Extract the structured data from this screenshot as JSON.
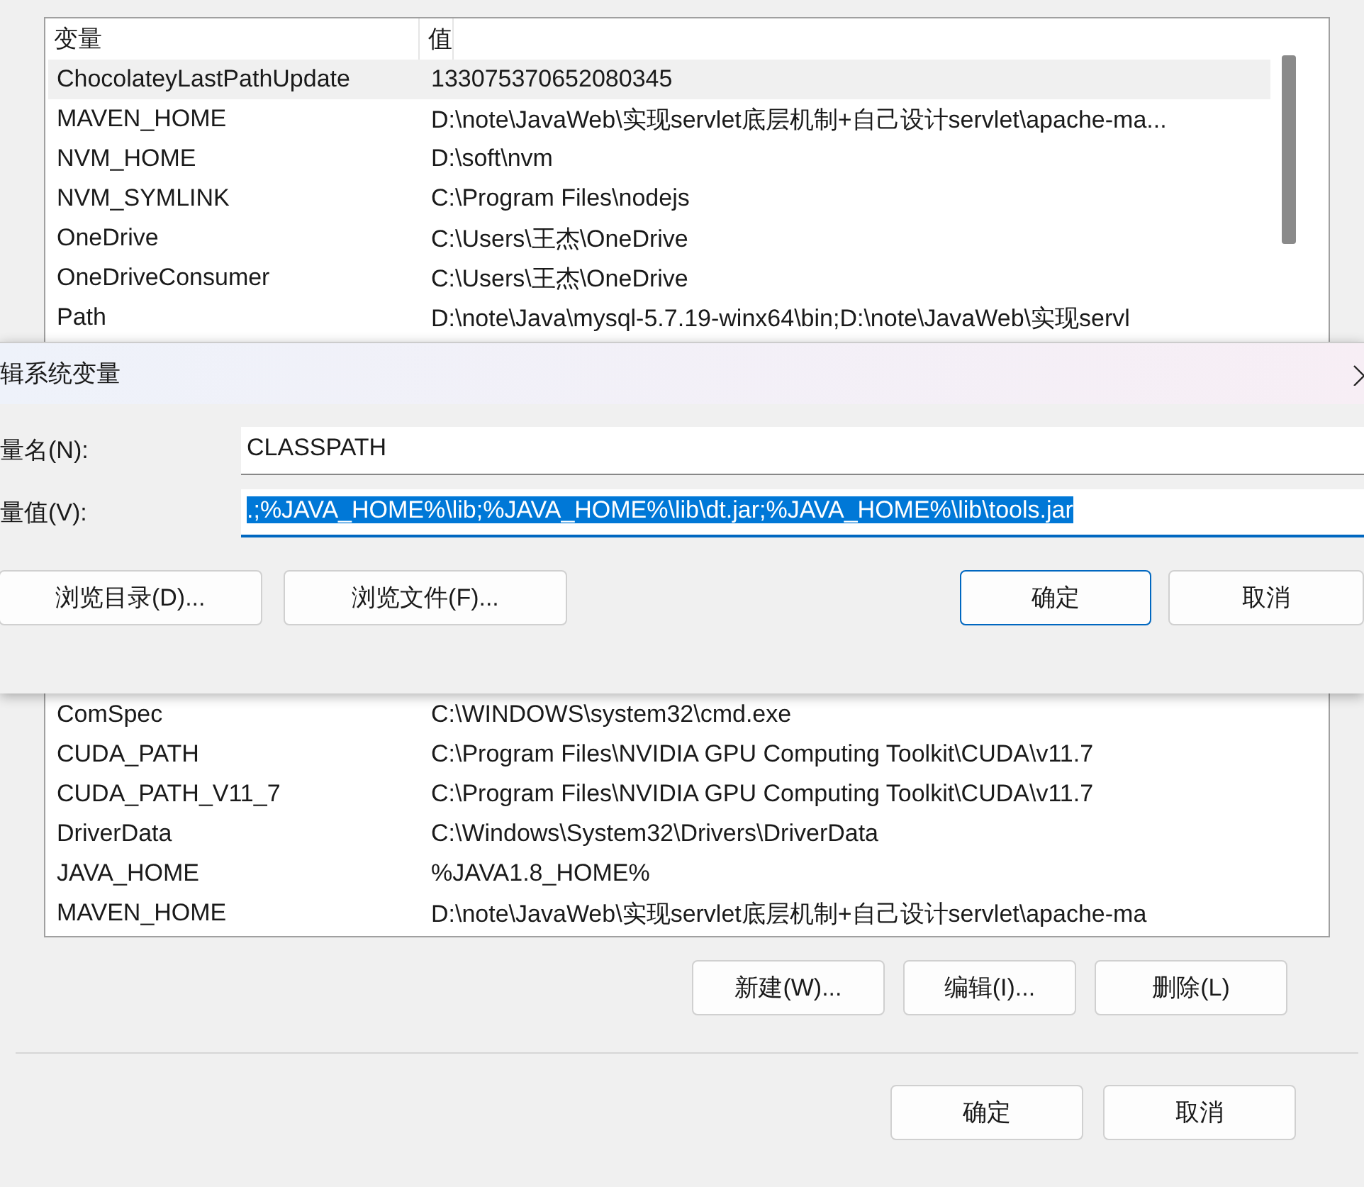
{
  "user_variables": {
    "columns": [
      "变量",
      "值"
    ],
    "rows": [
      {
        "name": "ChocolateyLastPathUpdate",
        "value": "133075370652080345",
        "selected": true
      },
      {
        "name": "MAVEN_HOME",
        "value": "D:\\note\\JavaWeb\\实现servlet底层机制+自己设计servlet\\apache-ma...",
        "selected": false
      },
      {
        "name": "NVM_HOME",
        "value": "D:\\soft\\nvm",
        "selected": false
      },
      {
        "name": "NVM_SYMLINK",
        "value": "C:\\Program Files\\nodejs",
        "selected": false
      },
      {
        "name": "OneDrive",
        "value": "C:\\Users\\王杰\\OneDrive",
        "selected": false
      },
      {
        "name": "OneDriveConsumer",
        "value": "C:\\Users\\王杰\\OneDrive",
        "selected": false
      },
      {
        "name": "Path",
        "value": "D:\\note\\Java\\mysql-5.7.19-winx64\\bin;D:\\note\\JavaWeb\\实现servl",
        "selected": false
      }
    ]
  },
  "dialog": {
    "title": "辑系统变量",
    "name_label": "量名(N):",
    "name_value": "CLASSPATH",
    "value_label": "量值(V):",
    "value_value": ".;%JAVA_HOME%\\lib;%JAVA_HOME%\\lib\\dt.jar;%JAVA_HOME%\\lib\\tools.jar",
    "value_selected": true,
    "buttons": [
      {
        "label": "浏览目录(D)...",
        "default": false
      },
      {
        "label": "浏览文件(F)...",
        "default": false
      },
      {
        "label": "确定",
        "default": true
      },
      {
        "label": "取消",
        "default": false
      }
    ]
  },
  "system_variables": {
    "rows": [
      {
        "name": "ComSpec",
        "value": "C:\\WINDOWS\\system32\\cmd.exe"
      },
      {
        "name": "CUDA_PATH",
        "value": "C:\\Program Files\\NVIDIA GPU Computing Toolkit\\CUDA\\v11.7"
      },
      {
        "name": "CUDA_PATH_V11_7",
        "value": "C:\\Program Files\\NVIDIA GPU Computing Toolkit\\CUDA\\v11.7"
      },
      {
        "name": "DriverData",
        "value": "C:\\Windows\\System32\\Drivers\\DriverData"
      },
      {
        "name": "JAVA_HOME",
        "value": "%JAVA1.8_HOME%"
      },
      {
        "name": "MAVEN_HOME",
        "value": "D:\\note\\JavaWeb\\实现servlet底层机制+自己设计servlet\\apache-ma"
      }
    ]
  },
  "list_buttons": [
    "新建(W)...",
    "编辑(I)...",
    "删除(L)"
  ],
  "window_buttons": [
    "确定",
    "取消"
  ]
}
